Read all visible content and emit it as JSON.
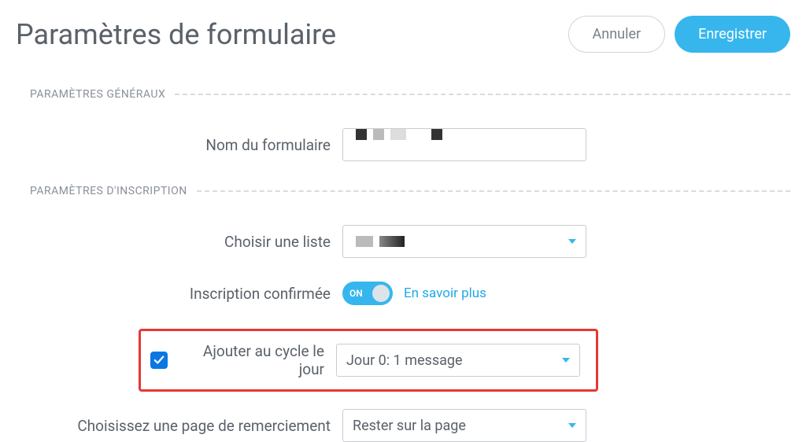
{
  "header": {
    "title": "Paramètres de formulaire",
    "cancel_label": "Annuler",
    "save_label": "Enregistrer"
  },
  "sections": {
    "general": {
      "title": "PARAMÈTRES GÉNÉRAUX",
      "form_name_label": "Nom du formulaire"
    },
    "inscription": {
      "title": "PARAMÈTRES D'INSCRIPTION",
      "choose_list_label": "Choisir une liste",
      "confirmed_label": "Inscription confirmée",
      "toggle_on_text": "ON",
      "learn_more": "En savoir plus",
      "add_to_cycle_label": "Ajouter au cycle le jour",
      "cycle_day_option": "Jour 0: 1 message",
      "thankyou_label": "Choisissez une page de remerciement",
      "thankyou_option": "Rester sur la page"
    }
  }
}
